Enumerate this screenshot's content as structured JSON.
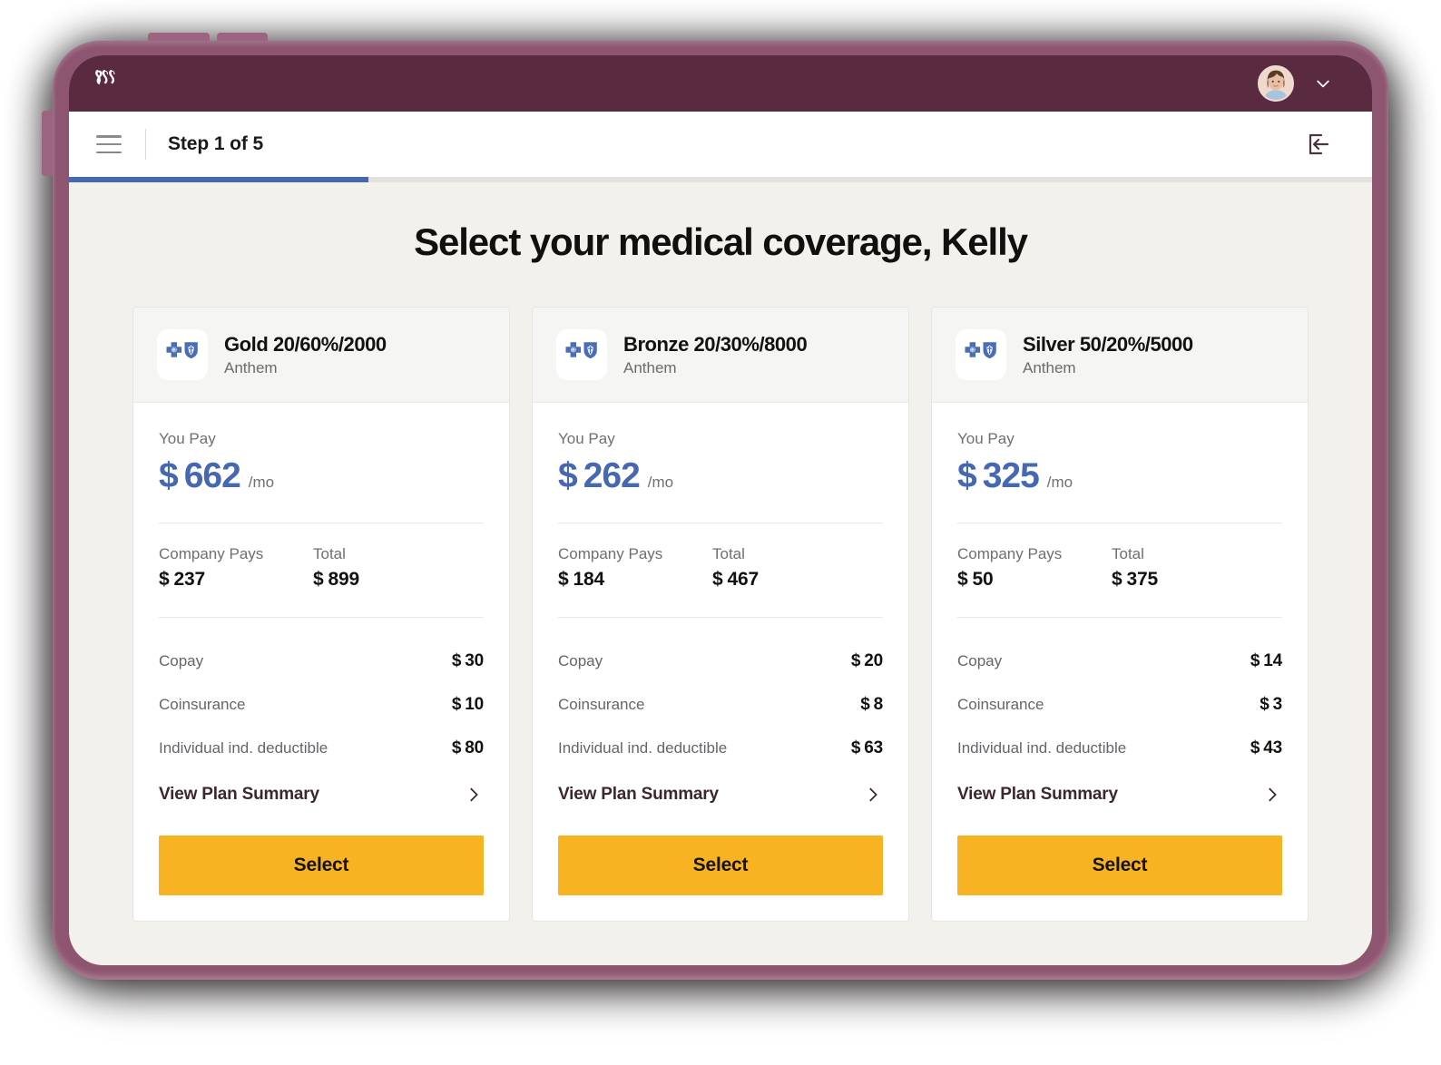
{
  "brand": {
    "logo_icon": "rippling-logo",
    "bar_color": "#5A2B40",
    "avatar_icon": "user-avatar-photo",
    "chevron_icon": "chevron-down-icon"
  },
  "topbar": {
    "menu_icon": "hamburger-menu-icon",
    "step_label": "Step 1 of 5",
    "exit_icon": "logout-icon",
    "progress_percent": 23,
    "progress_color": "#4668B3"
  },
  "page": {
    "title": "Select your medical coverage, Kelly",
    "background": "#F2F1EC"
  },
  "labels": {
    "you_pay": "You Pay",
    "per_month": "/mo",
    "company_pays": "Company Pays",
    "total": "Total",
    "copay": "Copay",
    "coinsurance": "Coinsurance",
    "deductible": "Individual ind. deductible",
    "view_summary": "View Plan Summary",
    "select": "Select",
    "currency": "$",
    "carrier_logo_icon": "anthem-bcbs-icon",
    "chevron_right_icon": "chevron-right-icon"
  },
  "colors": {
    "price_blue": "#4668B3",
    "select_button": "#F8B322",
    "card_header": "#F5F5F4"
  },
  "plans": [
    {
      "name": "Gold 20/60%/2000",
      "carrier": "Anthem",
      "you_pay": "662",
      "company_pays": "237",
      "total": "899",
      "copay": "30",
      "coinsurance": "10",
      "deductible": "80"
    },
    {
      "name": "Bronze 20/30%/8000",
      "carrier": "Anthem",
      "you_pay": "262",
      "company_pays": "184",
      "total": "467",
      "copay": "20",
      "coinsurance": "8",
      "deductible": "63"
    },
    {
      "name": "Silver 50/20%/5000",
      "carrier": "Anthem",
      "you_pay": "325",
      "company_pays": "50",
      "total": "375",
      "copay": "14",
      "coinsurance": "3",
      "deductible": "43"
    }
  ]
}
